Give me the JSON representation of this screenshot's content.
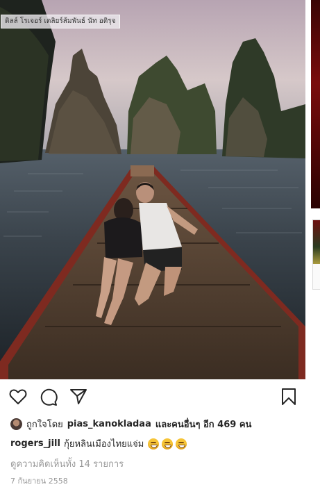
{
  "photo": {
    "watermark": "ดิลล์ โรเจอร์ เตลิยร์ส้มพันธ์ นัท อติรุจ",
    "description_icon": "boat-lake-photo"
  },
  "actions": {
    "like_icon": "heart-icon",
    "comment_icon": "comment-icon",
    "share_icon": "send-icon",
    "save_icon": "bookmark-icon"
  },
  "likes": {
    "prefix": "ถูกใจโดย",
    "user": "pias_kanokladaa",
    "suffix": "และคนอื่นๆ อีก 469 คน"
  },
  "caption": {
    "user": "rogers_jill",
    "text": "กุ้ยหลินเมืองไทยแจ่ม"
  },
  "comments_link": "ดูความคิดเห็นทั้ง 14 รายการ",
  "date": "7 กันยายน 2558"
}
